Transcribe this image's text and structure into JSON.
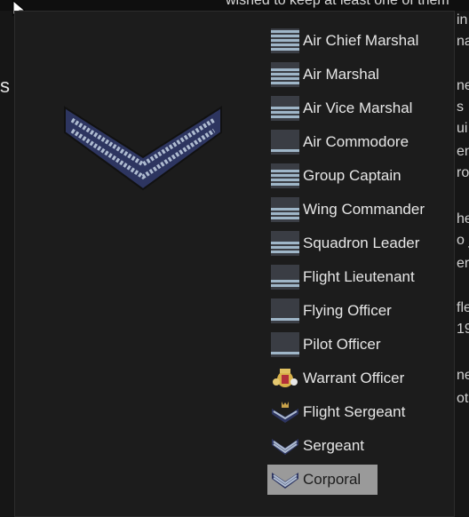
{
  "background": {
    "top_text": "wished to keep at least one of them",
    "right_fragments": [
      "in",
      "na",
      "ne",
      "s",
      "ui",
      "en",
      "ro",
      "he",
      "o j",
      "er",
      "fle",
      "19",
      "ne",
      "ot"
    ],
    "left_glyph": "s |"
  },
  "popup": {
    "selected_rank": "Corporal",
    "ranks": [
      {
        "label": "Air Chief Marshal",
        "icon": "sleeve-stripes-icon",
        "stripes": 5
      },
      {
        "label": "Air Marshal",
        "icon": "sleeve-stripes-icon",
        "stripes": 4
      },
      {
        "label": "Air Vice Marshal",
        "icon": "sleeve-stripes-icon",
        "stripes": 3
      },
      {
        "label": "Air Commodore",
        "icon": "sleeve-stripes-icon",
        "stripes": 1
      },
      {
        "label": "Group Captain",
        "icon": "sleeve-stripes-icon",
        "stripes": 4
      },
      {
        "label": "Wing Commander",
        "icon": "sleeve-stripes-icon",
        "stripes": 3
      },
      {
        "label": "Squadron Leader",
        "icon": "sleeve-stripes-icon",
        "stripes": 3
      },
      {
        "label": "Flight Lieutenant",
        "icon": "sleeve-stripes-icon",
        "stripes": 2
      },
      {
        "label": "Flying Officer",
        "icon": "sleeve-stripes-icon",
        "stripes": 1
      },
      {
        "label": "Pilot Officer",
        "icon": "sleeve-stripes-icon",
        "stripes": 1
      },
      {
        "label": "Warrant Officer",
        "icon": "royal-arms-icon"
      },
      {
        "label": "Flight Sergeant",
        "icon": "crown-chevron-icon"
      },
      {
        "label": "Sergeant",
        "icon": "chevron-icon"
      },
      {
        "label": "Corporal",
        "icon": "chevron-icon"
      }
    ]
  },
  "colors": {
    "stripe_light": "#9fb6c8",
    "stripe_dark": "#2a2f3a",
    "chevron_navy": "#2d3560",
    "chevron_stripe": "#aebbd0",
    "selected_bg": "#9a9a9a"
  }
}
